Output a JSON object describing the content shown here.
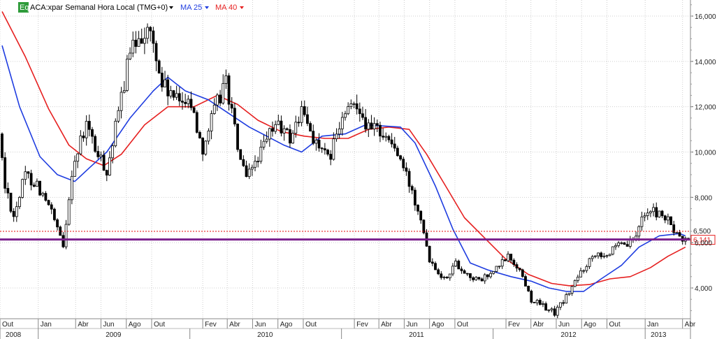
{
  "header": {
    "eq_badge": "Eq",
    "symbol_text": "ACA:xpar Semanal Hora Local (TMG+0)",
    "ma25_text": "MA 25",
    "ma40_text": "MA 40"
  },
  "colors": {
    "background": "#ffffff",
    "grid": "#cfcfcf",
    "candle": "#000000",
    "ma25": "#1f3de0",
    "ma40": "#e62020",
    "support_line": "#7a1f8c",
    "dotted_line": "#e62020",
    "eq_badge_bg": "#2e9b3a"
  },
  "chart_data": {
    "type": "candlestick",
    "title": "ACA:xpar Semanal Hora Local (TMG+0)",
    "ylim": [
      2600,
      16700
    ],
    "y_ticks": [
      4000,
      6000,
      8000,
      10000,
      12000,
      14000,
      16000
    ],
    "y_tick_labels": [
      "4,000",
      "6,000",
      "8,000",
      "10,000",
      "12,000",
      "14,000",
      "16,000"
    ],
    "x_start": "2008-10-06",
    "x_end": "2013-04-15",
    "month_ticks": [
      {
        "date": "2008-10-01",
        "label": "Out"
      },
      {
        "date": "2009-01-01",
        "label": "Jan"
      },
      {
        "date": "2009-04-01",
        "label": "Abr"
      },
      {
        "date": "2009-06-01",
        "label": "Jun"
      },
      {
        "date": "2009-08-01",
        "label": "Ago"
      },
      {
        "date": "2009-10-01",
        "label": "Out"
      },
      {
        "date": "2010-02-01",
        "label": "Fev"
      },
      {
        "date": "2010-04-01",
        "label": "Abr"
      },
      {
        "date": "2010-06-01",
        "label": "Jun"
      },
      {
        "date": "2010-08-01",
        "label": "Ago"
      },
      {
        "date": "2010-10-01",
        "label": "Out"
      },
      {
        "date": "2011-02-01",
        "label": "Fev"
      },
      {
        "date": "2011-04-01",
        "label": "Abr"
      },
      {
        "date": "2011-06-01",
        "label": "Jun"
      },
      {
        "date": "2011-08-01",
        "label": "Ago"
      },
      {
        "date": "2011-10-01",
        "label": "Out"
      },
      {
        "date": "2012-02-01",
        "label": "Fev"
      },
      {
        "date": "2012-04-01",
        "label": "Abr"
      },
      {
        "date": "2012-06-01",
        "label": "Jun"
      },
      {
        "date": "2012-08-01",
        "label": "Ago"
      },
      {
        "date": "2012-10-01",
        "label": "Out"
      },
      {
        "date": "2013-01-01",
        "label": "Jan"
      },
      {
        "date": "2013-04-01",
        "label": "Abr"
      }
    ],
    "year_labels": [
      {
        "date": "2008-10-01",
        "label": "2008"
      },
      {
        "date": "2009-01-01",
        "label": "2009"
      },
      {
        "date": "2010-01-01",
        "label": "2010"
      },
      {
        "date": "2011-01-01",
        "label": "2011"
      },
      {
        "date": "2012-01-01",
        "label": "2012"
      },
      {
        "date": "2013-01-01",
        "label": "2013"
      }
    ],
    "price_anchors": [
      [
        "2008-10-06",
        10800
      ],
      [
        "2008-10-20",
        8500
      ],
      [
        "2008-11-10",
        7200
      ],
      [
        "2008-12-08",
        9000
      ],
      [
        "2009-01-05",
        8600
      ],
      [
        "2009-02-09",
        7300
      ],
      [
        "2009-03-09",
        5800
      ],
      [
        "2009-03-30",
        9200
      ],
      [
        "2009-05-04",
        11200
      ],
      [
        "2009-06-01",
        9800
      ],
      [
        "2009-06-22",
        9200
      ],
      [
        "2009-07-13",
        11000
      ],
      [
        "2009-08-10",
        13800
      ],
      [
        "2009-09-07",
        15300
      ],
      [
        "2009-10-05",
        15200
      ],
      [
        "2009-11-02",
        13000
      ],
      [
        "2009-12-07",
        12200
      ],
      [
        "2010-01-04",
        12500
      ],
      [
        "2010-02-08",
        10200
      ],
      [
        "2010-03-08",
        11800
      ],
      [
        "2010-04-05",
        13200
      ],
      [
        "2010-05-03",
        10200
      ],
      [
        "2010-05-24",
        8700
      ],
      [
        "2010-06-14",
        9600
      ],
      [
        "2010-07-05",
        10200
      ],
      [
        "2010-08-02",
        11300
      ],
      [
        "2010-09-06",
        10600
      ],
      [
        "2010-10-04",
        11800
      ],
      [
        "2010-11-08",
        10400
      ],
      [
        "2010-12-06",
        9600
      ],
      [
        "2011-01-10",
        11400
      ],
      [
        "2011-02-14",
        12300
      ],
      [
        "2011-03-14",
        11000
      ],
      [
        "2011-04-11",
        11000
      ],
      [
        "2011-05-16",
        10200
      ],
      [
        "2011-06-20",
        8600
      ],
      [
        "2011-07-18",
        7200
      ],
      [
        "2011-08-08",
        5300
      ],
      [
        "2011-09-12",
        4400
      ],
      [
        "2011-10-10",
        5100
      ],
      [
        "2011-11-07",
        4600
      ],
      [
        "2011-12-05",
        4300
      ],
      [
        "2012-01-09",
        4700
      ],
      [
        "2012-02-13",
        5400
      ],
      [
        "2012-03-12",
        4800
      ],
      [
        "2012-04-09",
        3500
      ],
      [
        "2012-05-07",
        3200
      ],
      [
        "2012-06-04",
        2900
      ],
      [
        "2012-07-02",
        3600
      ],
      [
        "2012-08-06",
        4700
      ],
      [
        "2012-09-10",
        5600
      ],
      [
        "2012-10-08",
        5500
      ],
      [
        "2012-11-05",
        5800
      ],
      [
        "2012-12-10",
        6000
      ],
      [
        "2013-01-07",
        7400
      ],
      [
        "2013-02-11",
        7300
      ],
      [
        "2013-03-11",
        6800
      ],
      [
        "2013-03-25",
        6300
      ],
      [
        "2013-04-08",
        6100
      ]
    ],
    "ma25_anchors": [
      [
        "2008-10-06",
        14700
      ],
      [
        "2008-11-17",
        12000
      ],
      [
        "2009-01-05",
        9800
      ],
      [
        "2009-02-16",
        9000
      ],
      [
        "2009-03-30",
        8700
      ],
      [
        "2009-05-04",
        9300
      ],
      [
        "2009-06-15",
        10000
      ],
      [
        "2009-08-10",
        11500
      ],
      [
        "2009-10-05",
        12700
      ],
      [
        "2009-11-09",
        13300
      ],
      [
        "2009-12-21",
        12700
      ],
      [
        "2010-02-15",
        12300
      ],
      [
        "2010-04-05",
        11700
      ],
      [
        "2010-05-24",
        11100
      ],
      [
        "2010-07-05",
        10700
      ],
      [
        "2010-08-16",
        10300
      ],
      [
        "2010-09-27",
        10000
      ],
      [
        "2010-11-15",
        10700
      ],
      [
        "2011-01-10",
        10800
      ],
      [
        "2011-02-28",
        11200
      ],
      [
        "2011-04-11",
        11150
      ],
      [
        "2011-05-23",
        11100
      ],
      [
        "2011-06-27",
        10400
      ],
      [
        "2011-08-15",
        8500
      ],
      [
        "2011-09-26",
        6600
      ],
      [
        "2011-11-07",
        5100
      ],
      [
        "2011-12-19",
        4800
      ],
      [
        "2012-02-13",
        4500
      ],
      [
        "2012-04-02",
        4300
      ],
      [
        "2012-05-14",
        4000
      ],
      [
        "2012-06-25",
        3850
      ],
      [
        "2012-08-06",
        3850
      ],
      [
        "2012-09-17",
        4400
      ],
      [
        "2012-11-05",
        5000
      ],
      [
        "2012-12-17",
        5800
      ],
      [
        "2013-02-04",
        6300
      ],
      [
        "2013-03-25",
        6400
      ],
      [
        "2013-04-08",
        6300
      ]
    ],
    "ma40_anchors": [
      [
        "2008-10-06",
        16200
      ],
      [
        "2008-12-01",
        14200
      ],
      [
        "2009-01-26",
        11900
      ],
      [
        "2009-03-16",
        10300
      ],
      [
        "2009-04-27",
        9700
      ],
      [
        "2009-06-08",
        9400
      ],
      [
        "2009-07-20",
        9900
      ],
      [
        "2009-09-14",
        11200
      ],
      [
        "2009-11-09",
        12000
      ],
      [
        "2010-01-11",
        12000
      ],
      [
        "2010-03-08",
        12500
      ],
      [
        "2010-04-26",
        12100
      ],
      [
        "2010-06-14",
        11400
      ],
      [
        "2010-08-09",
        10900
      ],
      [
        "2010-10-04",
        10700
      ],
      [
        "2010-11-22",
        10600
      ],
      [
        "2011-01-17",
        10600
      ],
      [
        "2011-03-07",
        11000
      ],
      [
        "2011-04-25",
        11100
      ],
      [
        "2011-06-13",
        11000
      ],
      [
        "2011-07-25",
        9900
      ],
      [
        "2011-09-12",
        8400
      ],
      [
        "2011-10-24",
        7100
      ],
      [
        "2011-12-12",
        6200
      ],
      [
        "2012-01-30",
        5300
      ],
      [
        "2012-03-26",
        4600
      ],
      [
        "2012-05-21",
        4200
      ],
      [
        "2012-07-02",
        4100
      ],
      [
        "2012-08-20",
        4150
      ],
      [
        "2012-10-08",
        4400
      ],
      [
        "2012-11-26",
        4500
      ],
      [
        "2013-01-14",
        4900
      ],
      [
        "2013-02-25",
        5400
      ],
      [
        "2013-04-08",
        5800
      ]
    ],
    "horizontal_lines": [
      {
        "value": 6500,
        "style": "dotted",
        "label": "6,500"
      },
      {
        "value": 6141,
        "style": "solid",
        "label": "6,141"
      }
    ]
  }
}
